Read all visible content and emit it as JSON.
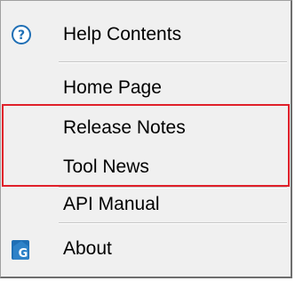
{
  "menu": {
    "items": [
      {
        "label": "Help Contents",
        "icon": "help-circle-icon"
      },
      {
        "label": "Home Page"
      },
      {
        "label": "Release Notes"
      },
      {
        "label": "Tool News"
      },
      {
        "label": "API Manual"
      },
      {
        "label": "About",
        "icon": "app-logo-icon"
      }
    ]
  },
  "colors": {
    "menu_background": "#f0f0f0",
    "highlight_border": "#e0202a",
    "icon_blue": "#1f6fb5"
  }
}
